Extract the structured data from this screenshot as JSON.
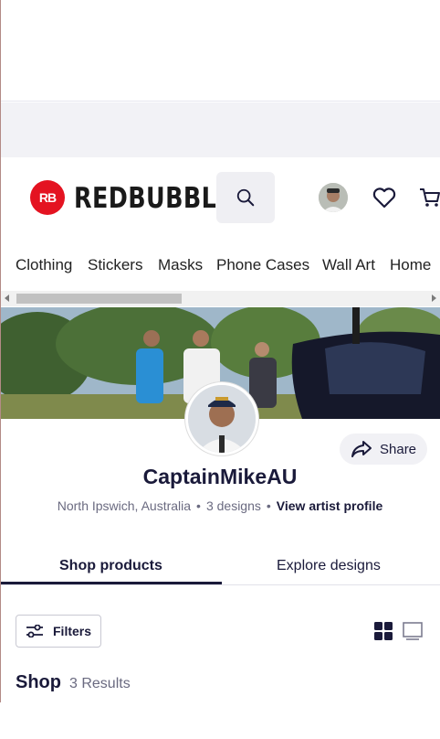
{
  "header": {
    "logo_mark": "RB",
    "logo_text": "REDBUBBLE",
    "search_icon": "search-icon",
    "heart_icon": "heart-icon",
    "cart_icon": "cart-icon",
    "accent_color": "#e41321"
  },
  "nav": {
    "items": [
      "Clothing",
      "Stickers",
      "Masks",
      "Phone Cases",
      "Wall Art",
      "Home"
    ]
  },
  "profile": {
    "name": "CaptainMikeAU",
    "location": "North Ipswich, Australia",
    "designs": "3 designs",
    "view_profile": "View artist profile",
    "share_label": "Share"
  },
  "tabs": {
    "shop_products": "Shop products",
    "explore_designs": "Explore designs"
  },
  "toolbar": {
    "filters_label": "Filters"
  },
  "shop": {
    "title": "Shop",
    "results": "3 Results"
  }
}
